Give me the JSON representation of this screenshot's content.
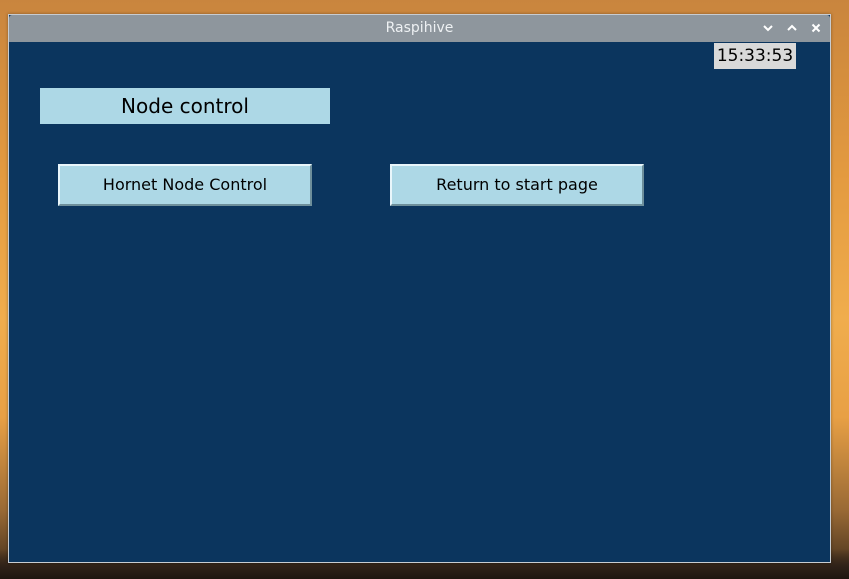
{
  "window": {
    "title": "Raspihive",
    "controls": {
      "minimize_icon": "chevron-down-icon",
      "maximize_icon": "chevron-up-icon",
      "close_icon": "close-icon"
    }
  },
  "clock": {
    "time": "15:33:53"
  },
  "page": {
    "heading": "Node control"
  },
  "buttons": {
    "hornet_node_control": "Hornet Node Control",
    "return_to_start": "Return to start page"
  },
  "colors": {
    "window_background": "#0b355e",
    "button_background": "#add8e6",
    "titlebar": "#8e969d",
    "clock_background": "#d9d9d9"
  }
}
